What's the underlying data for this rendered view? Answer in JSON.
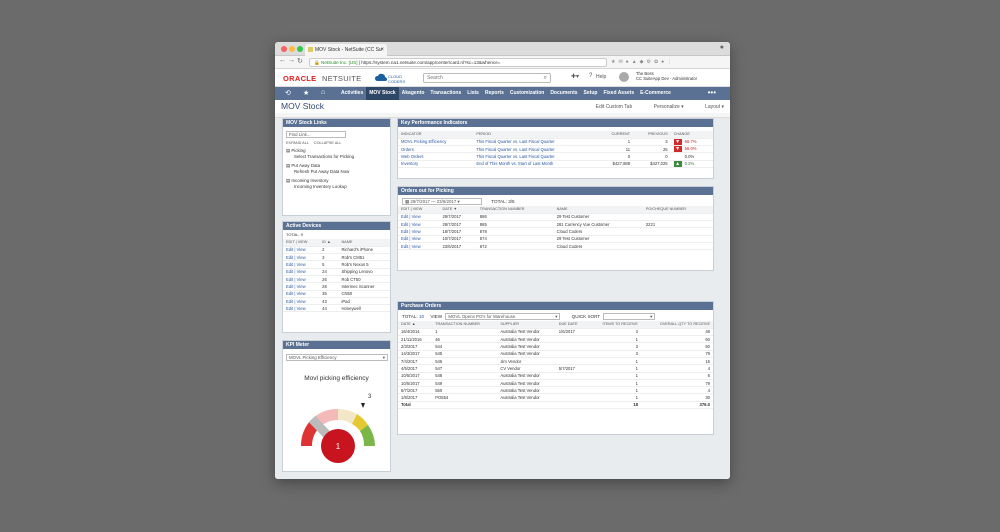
{
  "browser": {
    "tab_title": "MOV Stock - NetSuite (CC Su",
    "url_secure_label": "NetSuite Inc. [US]",
    "url": "https://system.na1.netsuite.com/app/center/card.nl?sc=13&whence="
  },
  "header": {
    "oracle": "ORACLE",
    "netsuite": "NETSUITE",
    "cloud_logo": "CLOUD CODERS",
    "search_placeholder": "Search",
    "help": "Help",
    "user_name": "The Boss",
    "user_role": "CC SuiteApp Dev - Administrator"
  },
  "menubar": {
    "items": [
      "Activities",
      "MOV Stock",
      "Akagento",
      "Transactions",
      "Lists",
      "Reports",
      "Customization",
      "Documents",
      "Setup",
      "Fixed Assets",
      "E-Commerce"
    ],
    "more": "•••"
  },
  "page": {
    "title": "MOV Stock",
    "edit_tab": "Edit Custom Tab",
    "personalize": "Personalize",
    "layout": "Layout"
  },
  "links_portlet": {
    "title": "MOV Stock Links",
    "find_placeholder": "Find Link...",
    "expand_all": "EXPAND ALL",
    "collapse_all": "COLLAPSE ALL",
    "groups": [
      {
        "name": "Picking",
        "link": "Select Transactions for Picking"
      },
      {
        "name": "Put Away Data",
        "link": "Refresh Put Away Data Now"
      },
      {
        "name": "Incoming Inventory",
        "link": "Incoming Inventory Lookup"
      }
    ]
  },
  "devices": {
    "title": "Active Devices",
    "total": "TOTAL: 9",
    "headers": [
      "EDIT | VIEW",
      "ID ▲",
      "NAME"
    ],
    "rows": [
      [
        "Edit | View",
        "2",
        "Richard's iPhone"
      ],
      [
        "Edit | View",
        "3",
        "Rob's CM51"
      ],
      [
        "Edit | View",
        "5",
        "Rob's Nexus 5"
      ],
      [
        "Edit | View",
        "24",
        "Shipping Lenovo"
      ],
      [
        "Edit | View",
        "26",
        "Rob CT50"
      ],
      [
        "Edit | View",
        "28",
        "Intermec Scanner"
      ],
      [
        "Edit | View",
        "35",
        "CN50"
      ],
      [
        "Edit | View",
        "43",
        "iPad"
      ],
      [
        "Edit | View",
        "44",
        "Honeywell"
      ]
    ]
  },
  "kpi_meter": {
    "title": "KPI Meter",
    "select": "MOVL Picking Efficiency",
    "gauge_title": "Movl picking efficiency",
    "gauge_max": "3",
    "value": "1",
    "value_fraction": 0.33
  },
  "kpis": {
    "title": "Key Performance Indicators",
    "headers": [
      "INDICATOR",
      "PERIOD",
      "CURRENT",
      "PREVIOUS",
      "CHANGE"
    ],
    "rows": [
      {
        "indicator": "MOVL Picking Efficiency",
        "period": "This Fiscal Quarter vs. Last Fiscal Quarter",
        "current": "1",
        "previous": "3",
        "change": "66.7%",
        "dir": "down"
      },
      {
        "indicator": "Orders",
        "period": "This Fiscal Quarter vs. Last Fiscal Quarter",
        "current": "11",
        "previous": "25",
        "change": "56.0%",
        "dir": "down"
      },
      {
        "indicator": "Web Orders",
        "period": "This Fiscal Quarter vs. Last Fiscal Quarter",
        "current": "0",
        "previous": "0",
        "change": "0.0%",
        "dir": "none"
      },
      {
        "indicator": "Inventory",
        "period": "End of This Month vs. Start of Last Month",
        "current": "$427,888",
        "previous": "$427,025",
        "change": "0.2%",
        "dir": "up"
      }
    ]
  },
  "orders_picking": {
    "title": "Orders out for Picking",
    "date_range": "29/7/2017 — 23/6/2017",
    "total": "TOTAL: 3/5",
    "headers": [
      "EDIT | VIEW",
      "DATE ▼",
      "TRANSACTION NUMBER",
      "NAME",
      "PO/CHEQUE NUMBER"
    ],
    "rows": [
      [
        "Edit | View",
        "29/7/2017",
        "886",
        "29 Test Customer",
        ""
      ],
      [
        "Edit | View",
        "29/7/2017",
        "885",
        "281 Currency Vue Customer",
        "2221"
      ],
      [
        "Edit | View",
        "18/7/2017",
        "878",
        "Cloud Coders",
        ""
      ],
      [
        "Edit | View",
        "10/7/2017",
        "874",
        "29 Test Customer",
        ""
      ],
      [
        "Edit | View",
        "23/6/2017",
        "872",
        "Cloud Coders",
        ""
      ]
    ]
  },
  "purchase_orders": {
    "title": "Purchase Orders",
    "total_label": "TOTAL:",
    "total_value": "10",
    "view_label": "VIEW",
    "view_value": "MOVL Opens PO's for Warehouse",
    "quick_sort": "QUICK SORT",
    "headers": [
      "DATE ▲",
      "TRANSACTION NUMBER",
      "SUPPLIER",
      "DUE DATE",
      "ITEMS TO RECEIVE",
      "OVERALL QTY TO RECEIVE"
    ],
    "rows": [
      [
        "16/4/2014",
        "1",
        "Australia Test Vendor",
        "1/6/2017",
        "3",
        "48"
      ],
      [
        "21/11/2016",
        "46",
        "Australia Test Vendor",
        "",
        "1",
        "60"
      ],
      [
        "2/3/2017",
        "544",
        "Australia Test Vendor",
        "",
        "3",
        "50"
      ],
      [
        "14/3/2017",
        "545",
        "Australia Test Vendor",
        "",
        "3",
        "79"
      ],
      [
        "7/4/2017",
        "546",
        "Jim Vendor",
        "",
        "1",
        "16"
      ],
      [
        "4/5/2017",
        "547",
        "CV Vendor",
        "5/7/2017",
        "1",
        "4"
      ],
      [
        "10/5/2017",
        "548",
        "Australia Test Vendor",
        "",
        "1",
        "6"
      ],
      [
        "10/5/2017",
        "549",
        "Australia Test Vendor",
        "",
        "1",
        "79"
      ],
      [
        "6/7/2017",
        "550",
        "Australia Test Vendor",
        "",
        "1",
        "4"
      ],
      [
        "1/8/2017",
        "PO554",
        "Australia Test Vendor",
        "",
        "1",
        "30"
      ]
    ],
    "total_row": [
      "Total",
      "",
      "",
      "",
      "18",
      "376.0"
    ]
  }
}
